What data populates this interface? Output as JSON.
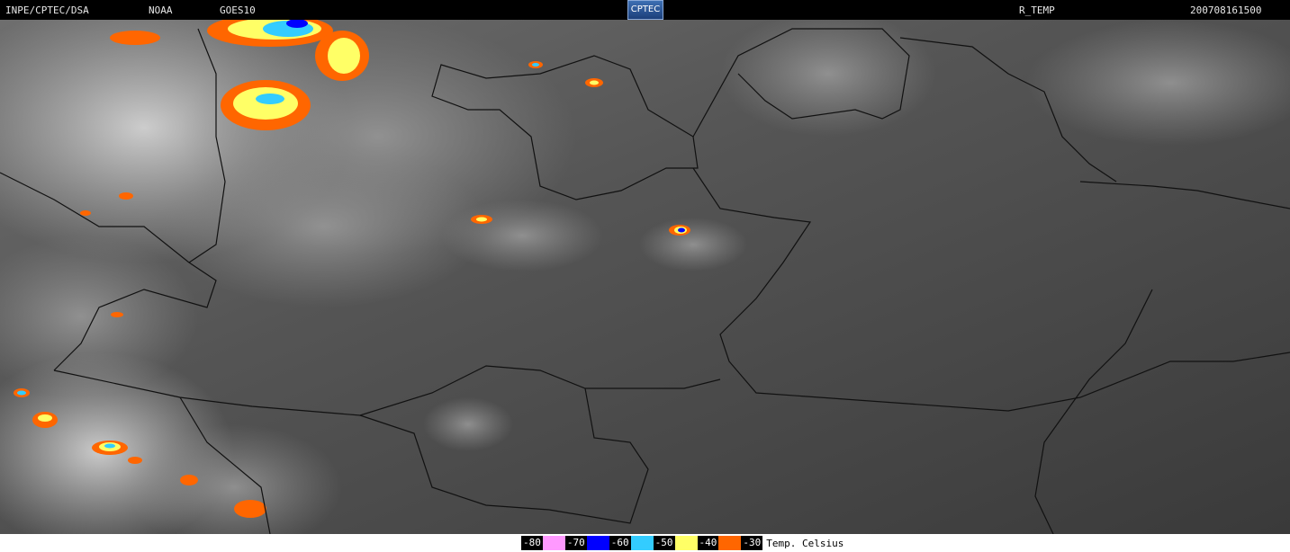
{
  "header": {
    "source": "INPE/CPTEC/DSA",
    "agency": "NOAA",
    "satellite": "GOES10",
    "logo": "CPTEC",
    "product": "R_TEMP",
    "timestamp": "200708161500"
  },
  "legend": {
    "ticks": [
      "-80",
      "-70",
      "-60",
      "-50",
      "-40",
      "-30"
    ],
    "colors": [
      "#ff99ff",
      "#0000ff",
      "#33ccff",
      "#ffff66",
      "#ff6600"
    ],
    "unit_label": "Temp. Celsius"
  }
}
